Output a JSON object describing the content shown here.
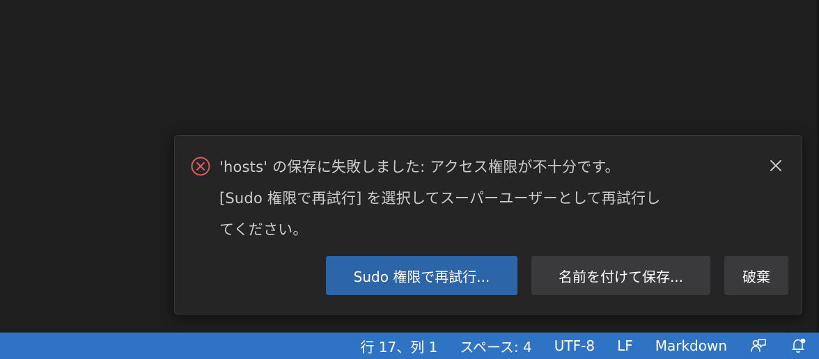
{
  "notification": {
    "message_line1": "'hosts' の保存に失敗しました: アクセス権限が不十分です。",
    "message_line2": "[Sudo 権限で再試行] を選択してスーパーユーザーとして再試行し",
    "message_line3": "てください。",
    "icon": "error-circle-x-icon",
    "close_icon": "close-icon",
    "error_color": "#e05a5a",
    "actions": {
      "retry_sudo": "Sudo 権限で再試行...",
      "save_as": "名前を付けて保存...",
      "discard": "破棄"
    }
  },
  "statusbar": {
    "cursor_position": "行 17、列 1",
    "indentation": "スペース: 4",
    "encoding": "UTF-8",
    "eol": "LF",
    "language": "Markdown",
    "feedback_icon": "feedback-icon",
    "notifications_icon": "bell-icon",
    "background_color": "#2f73c4"
  }
}
